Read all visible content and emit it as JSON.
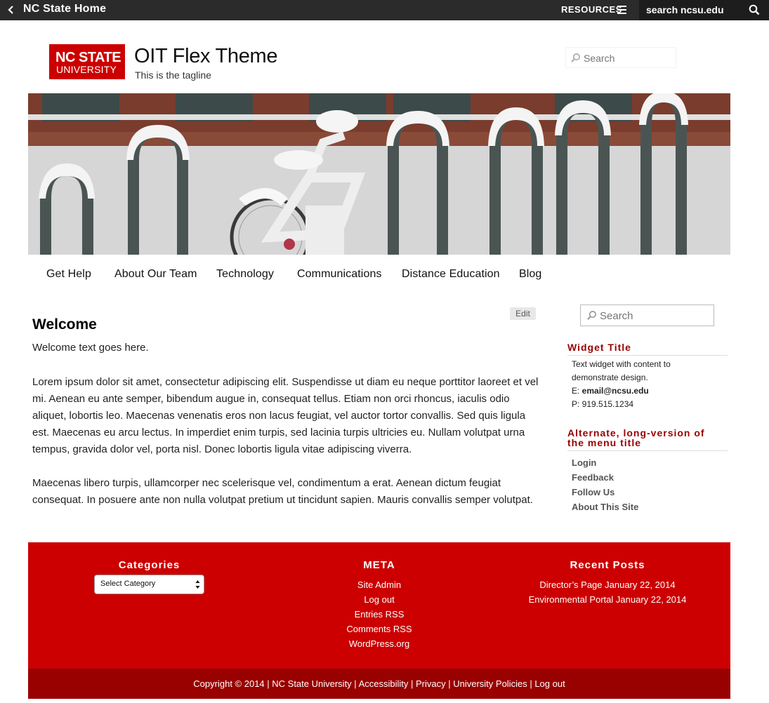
{
  "topbar": {
    "home_label": "NC State Home",
    "resources_label": "RESOURCES",
    "search_value": "search ncsu.edu"
  },
  "header": {
    "logo_line1": "NC STATE",
    "logo_line2": "UNIVERSITY",
    "site_title": "OIT Flex Theme",
    "tagline": "This is the tagline",
    "search_placeholder": "Search"
  },
  "nav": {
    "items": [
      {
        "label": "Get Help"
      },
      {
        "label": "About Our Team"
      },
      {
        "label": "Technology"
      },
      {
        "label": "Communications"
      },
      {
        "label": "Distance Education"
      },
      {
        "label": "Blog"
      }
    ]
  },
  "main": {
    "edit_label": "Edit",
    "title": "Welcome",
    "paragraphs": [
      "Welcome text goes here.",
      "Lorem ipsum dolor sit amet, consectetur adipiscing elit. Suspendisse ut diam eu neque porttitor laoreet et vel mi. Aenean eu ante semper, bibendum augue in, consequat tellus. Etiam non orci rhoncus, iaculis odio aliquet, lobortis leo. Maecenas venenatis eros non lacus feugiat, vel auctor tortor convallis. Sed quis ligula est. Maecenas eu arcu lectus. In imperdiet enim turpis, sed lacinia turpis ultricies eu. Nullam volutpat urna tempus, gravida dolor vel, porta nisl. Donec lobortis ligula vitae adipiscing viverra.",
      "Maecenas libero turpis, ullamcorper nec scelerisque vel, condimentum a erat. Aenean dictum feugiat consequat. In posuere ante non nulla volutpat pretium ut tincidunt sapien. Mauris convallis semper volutpat."
    ]
  },
  "sidebar": {
    "search_placeholder": "Search",
    "widget1": {
      "title": "Widget Title",
      "line1": "Text widget with content to",
      "line2": "demonstrate design.",
      "email_prefix": "E: ",
      "email": "email@ncsu.edu",
      "phone": "P: 919.515.1234"
    },
    "widget2": {
      "title_line1": "Alternate, long-version of",
      "title_line2": "the menu title",
      "links": [
        "Login",
        "Feedback",
        "Follow Us",
        "About This Site"
      ]
    }
  },
  "footer": {
    "categories_title": "Categories",
    "select_value": "Select Category",
    "meta_title": "META",
    "meta_links": [
      "Site Admin",
      "Log out",
      "Entries RSS",
      "Comments RSS",
      "WordPress.org"
    ],
    "recent_title": "Recent Posts",
    "recent_posts": [
      {
        "title": "Director’s Page",
        "date": "January 22, 2014"
      },
      {
        "title": "Environmental Portal",
        "date": "January 22, 2014"
      }
    ],
    "copyright": "Copyright © 2014",
    "bottom_links": [
      "NC State University",
      "Accessibility",
      "Privacy",
      "University Policies",
      "Log out"
    ]
  },
  "colors": {
    "brand_red": "#cc0000",
    "dark_red": "#990000",
    "topbar": "#2b2b2b"
  },
  "icons": [
    "chevron-left-icon",
    "hamburger-menu-icon",
    "search-icon"
  ]
}
